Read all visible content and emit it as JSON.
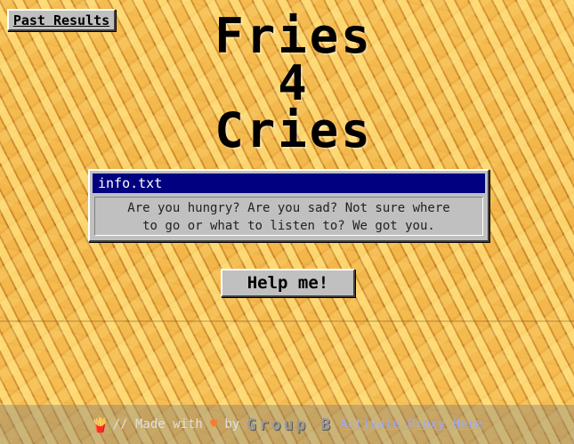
{
  "nav": {
    "past_results_label": "Past Results"
  },
  "title": {
    "line1": "Fries",
    "line2": "4",
    "line3": "Cries"
  },
  "dialog": {
    "title": "info.txt",
    "message_line1": "Are you hungry? Are you sad? Not sure where",
    "message_line2": "to go or what to listen to? We got you."
  },
  "cta": {
    "help_label": "Help me!"
  },
  "footer": {
    "icon": "fries-icon",
    "made_with": "// Made with",
    "heart": "♥",
    "by": "by",
    "group_name": "Group B",
    "proxy_link": "Activate Proxy Here"
  },
  "colors": {
    "titlebar": "#000080",
    "window_gray": "#c0c0c0",
    "heart": "#ff7a30",
    "link": "#9aa9ff"
  }
}
